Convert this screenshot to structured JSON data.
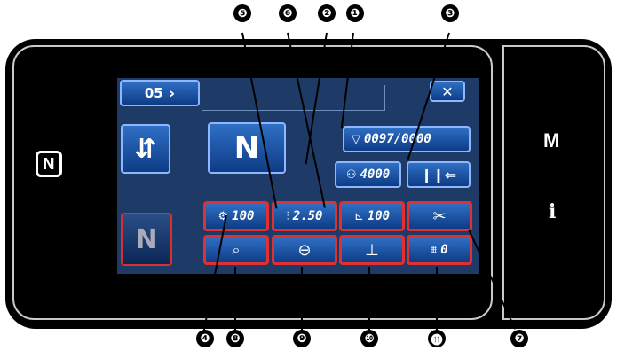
{
  "screen": {
    "pattern_button_label": "05",
    "close_label": "✕",
    "counter_value": "0097/0000",
    "bobbin_value": "4000",
    "max_speed_value": "100",
    "stitch_length_value": "2.50",
    "presser_value": "100",
    "reverse_value": "0",
    "nfc_label": "N",
    "menu_label": "M",
    "info_label": "i"
  },
  "callouts": [
    "❶",
    "❷",
    "❸",
    "❹",
    "❺",
    "❻",
    "❼",
    "❽",
    "❾",
    "❿",
    "⓫"
  ],
  "colors": {
    "accent": "#1a4f9e",
    "highlight": "#e03030",
    "screen": "#1e3a66"
  }
}
